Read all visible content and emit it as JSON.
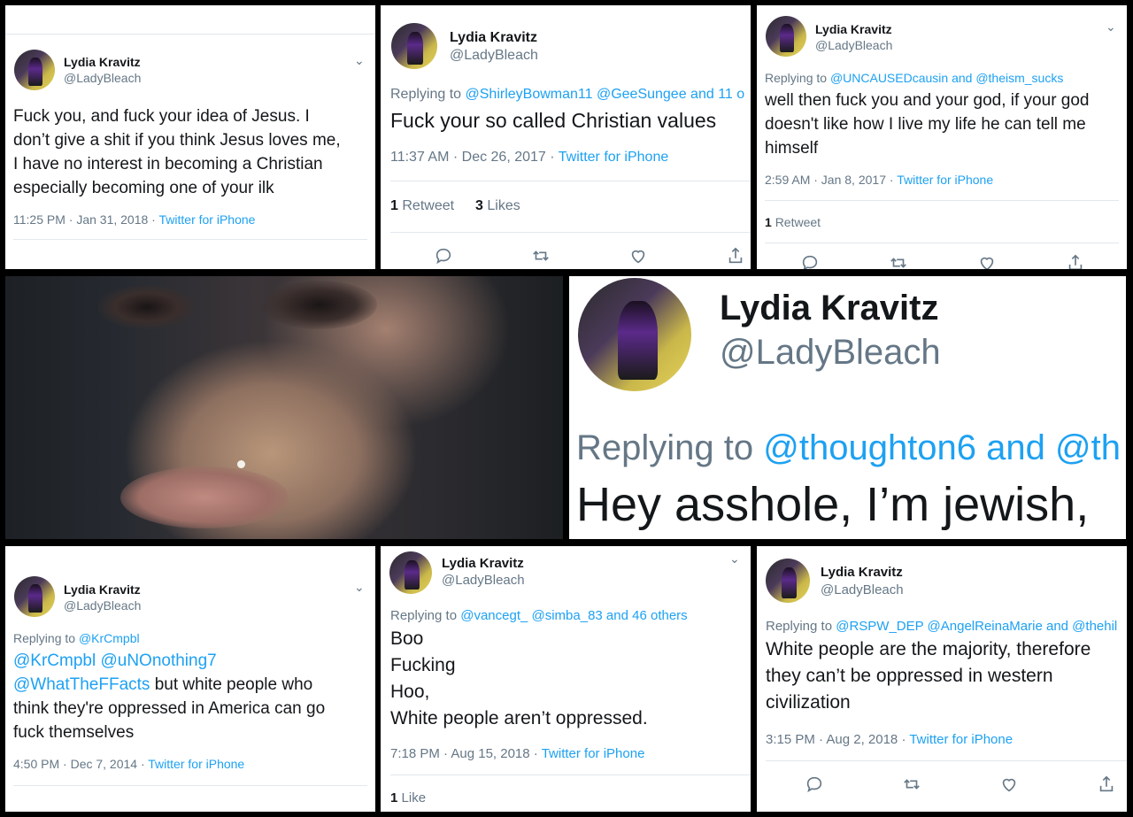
{
  "user": {
    "name": "Lydia Kravitz",
    "handle": "@LadyBleach"
  },
  "tweets": [
    {
      "text": "Fuck you, and fuck your idea of Jesus.  I\ndon’t give a shit if you think Jesus loves me,\nI have no interest in becoming a Christian\nespecially becoming one of your ilk",
      "time": "11:25 PM · Jan 31, 2018",
      "source": "Twitter for iPhone"
    },
    {
      "reply_prefix": "Replying to ",
      "reply_to": "@ShirleyBowman11 @GeeSungee and 11 o",
      "text": "Fuck your so called Christian values",
      "time": "11:37 AM · Dec 26, 2017",
      "source": "Twitter for iPhone",
      "retweets": "1",
      "retweets_label": "Retweet",
      "likes": "3",
      "likes_label": "Likes"
    },
    {
      "reply_prefix": "Replying to ",
      "reply_to": "@UNCAUSEDcausin and @theism_sucks",
      "text": "well then fuck you and your god, if your god\ndoesn't like how I live my life he can tell me\nhimself",
      "time": "2:59 AM · Jan 8, 2017",
      "source": "Twitter for iPhone",
      "retweets": "1",
      "retweets_label": "Retweet"
    },
    {
      "reply_prefix": "Replying to ",
      "reply_to": "@thoughton6 and @th",
      "text": "Hey asshole, I’m jewish,"
    },
    {
      "reply_prefix": "Replying to ",
      "reply_to": "@KrCmpbl",
      "mentions_line1": "@KrCmpbl @uNOnothing7",
      "mention_line2": "@WhatTheFFacts",
      "text_after_mentions": " but white people who",
      "text": "think they're oppressed in America can go\nfuck themselves",
      "time": "4:50 PM · Dec 7, 2014",
      "source": "Twitter for iPhone"
    },
    {
      "reply_prefix": "Replying to ",
      "reply_to": "@vancegt_ @simba_83 and 46 others",
      "text": "Boo\nFucking\nHoo,\nWhite people aren’t oppressed.",
      "time": "7:18 PM · Aug 15, 2018",
      "source": "Twitter for iPhone",
      "likes": "1",
      "likes_label": "Like"
    },
    {
      "reply_prefix": "Replying to ",
      "reply_to": "@RSPW_DEP @AngelReinaMarie and @thehil",
      "text": "White people are the majority, therefore\nthey can’t be oppressed in western\ncivilization",
      "time": "3:15 PM · Aug 2, 2018",
      "source": "Twitter for iPhone"
    }
  ],
  "icons": {
    "reply": "reply-icon",
    "retweet": "retweet-icon",
    "like": "like-icon",
    "share": "share-icon",
    "menu": "chevron-down-icon"
  },
  "colors": {
    "link": "#1da1f2",
    "muted": "#657786",
    "text": "#14171a",
    "background": "#000000"
  }
}
